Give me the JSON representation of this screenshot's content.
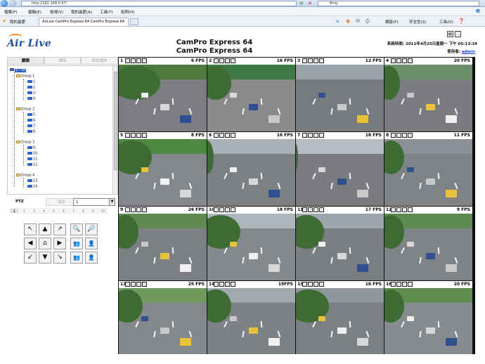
{
  "browser": {
    "address": "http://192.168.0.67/",
    "search_placeholder": "Bing",
    "menu": [
      "檔案(F)",
      "編輯(E)",
      "檢視(V)",
      "我的最愛(A)",
      "工具(T)",
      "說明(H)"
    ],
    "favorites_label": "我的最愛",
    "tab_title": "AirLive CamPro Express 64 CamPro Express 64",
    "commands": [
      "網頁(P)",
      "安全性(S)",
      "工具(O)"
    ]
  },
  "header": {
    "logo": "Air Live",
    "title_line1": "CamPro Express 64",
    "title_line2": "CamPro Express 64",
    "system_time": "系統時間: 2011年4月25日星期一 下午 05:13:34",
    "user_prefix": "使用者: ",
    "user_name": "admin"
  },
  "left_tabs": [
    "鏡頭",
    "擷取",
    "錄影播放"
  ],
  "tree": {
    "root": "1 - 16",
    "groups": [
      {
        "label": "Group 1",
        "cams": [
          "1.",
          "2.",
          "3.",
          "4."
        ]
      },
      {
        "label": "Group 2",
        "cams": [
          "5.",
          "6.",
          "7.",
          "8."
        ]
      },
      {
        "label": "Group 3",
        "cams": [
          "9.",
          "10.",
          "11.",
          "12."
        ]
      },
      {
        "label": "Group 4",
        "cams": [
          "13.",
          "14."
        ]
      }
    ]
  },
  "ptz": {
    "label": "PTZ",
    "second_tab": "鏡頭",
    "select_value": "1",
    "presets": [
      "1",
      "2",
      "3",
      "4",
      "5",
      "6",
      "7",
      "8",
      "9",
      "10"
    ]
  },
  "cameras": [
    {
      "num": "1",
      "fps": "6 FPS"
    },
    {
      "num": "2",
      "fps": "16 FPS"
    },
    {
      "num": "3",
      "fps": "12 FPS"
    },
    {
      "num": "4",
      "fps": "20 FPS"
    },
    {
      "num": "5",
      "fps": "8 FPS"
    },
    {
      "num": "6",
      "fps": "16 FPS"
    },
    {
      "num": "7",
      "fps": "18 FPS"
    },
    {
      "num": "8",
      "fps": "11 FPS"
    },
    {
      "num": "9",
      "fps": "26 FPS"
    },
    {
      "num": "10",
      "fps": "18 FPS"
    },
    {
      "num": "11",
      "fps": "17 FPS"
    },
    {
      "num": "12",
      "fps": "9 FPS"
    },
    {
      "num": "13",
      "fps": "25 FPS"
    },
    {
      "num": "14",
      "fps": "19FPS"
    },
    {
      "num": "15",
      "fps": "16 FPS"
    },
    {
      "num": "16",
      "fps": "20 FPS"
    }
  ],
  "colors": {
    "brand_blue": "#1c4fa3",
    "brand_orange": "#f28a1c",
    "user_link": "#1a3fd1"
  }
}
